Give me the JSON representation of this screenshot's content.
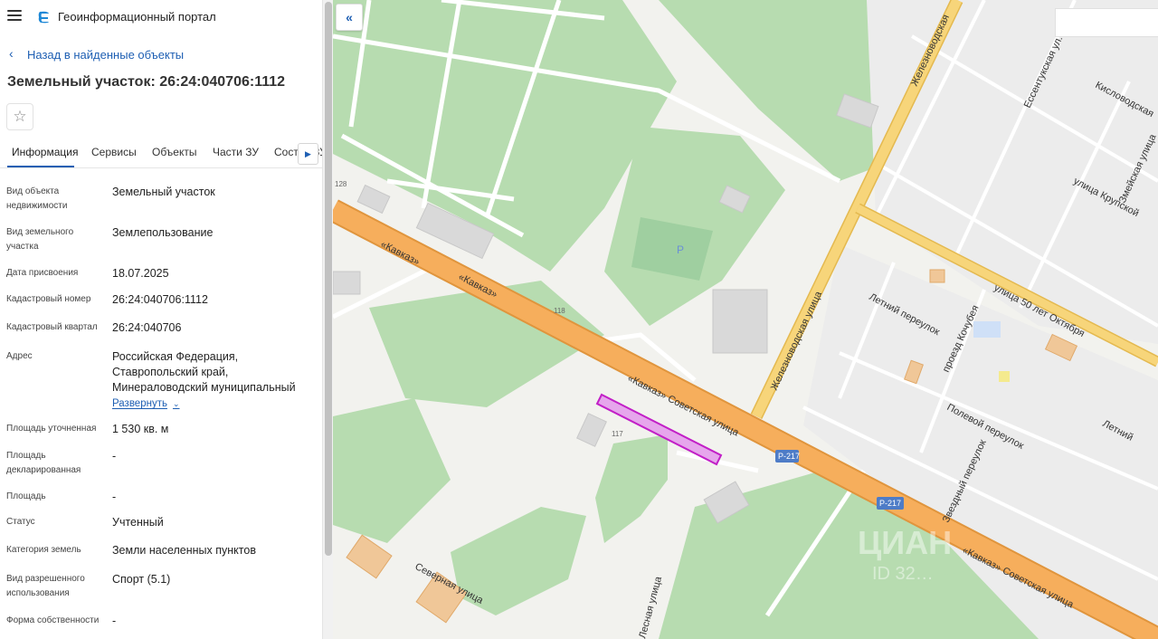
{
  "app": {
    "title": "Геоинформационный портал"
  },
  "nav": {
    "back_label": "Назад в найденные объекты"
  },
  "parcel": {
    "title": "Земельный участок: 26:24:040706:1112"
  },
  "tabs": [
    {
      "label": "Информация"
    },
    {
      "label": "Сервисы"
    },
    {
      "label": "Объекты"
    },
    {
      "label": "Части ЗУ"
    },
    {
      "label": "Состав ЗУ"
    }
  ],
  "properties": [
    {
      "label": "Вид объекта недвижимости",
      "value": "Земельный участок"
    },
    {
      "label": "Вид земельного участка",
      "value": "Землепользование"
    },
    {
      "label": "Дата присвоения",
      "value": "18.07.2025"
    },
    {
      "label": "Кадастровый номер",
      "value": "26:24:040706:1112"
    },
    {
      "label": "Кадастровый квартал",
      "value": "26:24:040706"
    },
    {
      "label": "Адрес",
      "value": "Российская Федерация, Ставропольский край, Минераловодский муниципальный",
      "expand_label": "Развернуть"
    },
    {
      "label": "Площадь уточненная",
      "value": "1 530 кв. м"
    },
    {
      "label": "Площадь декларированная",
      "value": "-"
    },
    {
      "label": "Площадь",
      "value": "-"
    },
    {
      "label": "Статус",
      "value": "Учтенный"
    },
    {
      "label": "Категория земель",
      "value": "Земли населенных пунктов"
    },
    {
      "label": "Вид разрешенного использования",
      "value": "Спорт (5.1)"
    },
    {
      "label": "Форма собственности",
      "value": "-"
    }
  ],
  "map": {
    "streets": {
      "kavkaz_1": "«Кавказ»",
      "kavkaz_2": "«Кавказ»",
      "kavkaz_sovetskaya": "«Кавказ» Советская улица",
      "kavkaz_sovetskaya_2": "«Кавказ» Советская улица",
      "zheleznovodskaya": "Железноводская улица",
      "zheleznovodskaya_top": "Железноводская",
      "essentukskaya": "Ессентукская ул.",
      "kislovodskaya": "Кисловодская",
      "zmeyskaya": "Змейская улица",
      "krupskoy": "улица Крупской",
      "fifty_let": "улица 50 лет Октября",
      "letny": "Летний переулок",
      "letny_2": "Летний",
      "kochubeya": "проезд Кочубея",
      "polevoy": "Полевой переулок",
      "zvezdny": "Звездный переулок",
      "severnaya": "Северная улица",
      "lesnaya": "Лесная улица"
    },
    "road_badges": [
      "Р-217",
      "Р-217"
    ],
    "building_numbers": [
      "128",
      "118",
      "117"
    ],
    "parking_symbol": "P",
    "watermark": "ЦИАН",
    "watermark_id": "ID 32…"
  },
  "colors": {
    "accent": "#1e5fb3",
    "road_major": "#f6ae5c",
    "road_secondary": "#f7d57a",
    "green": "#b7dcb0",
    "parcel": "#d84fd8"
  }
}
